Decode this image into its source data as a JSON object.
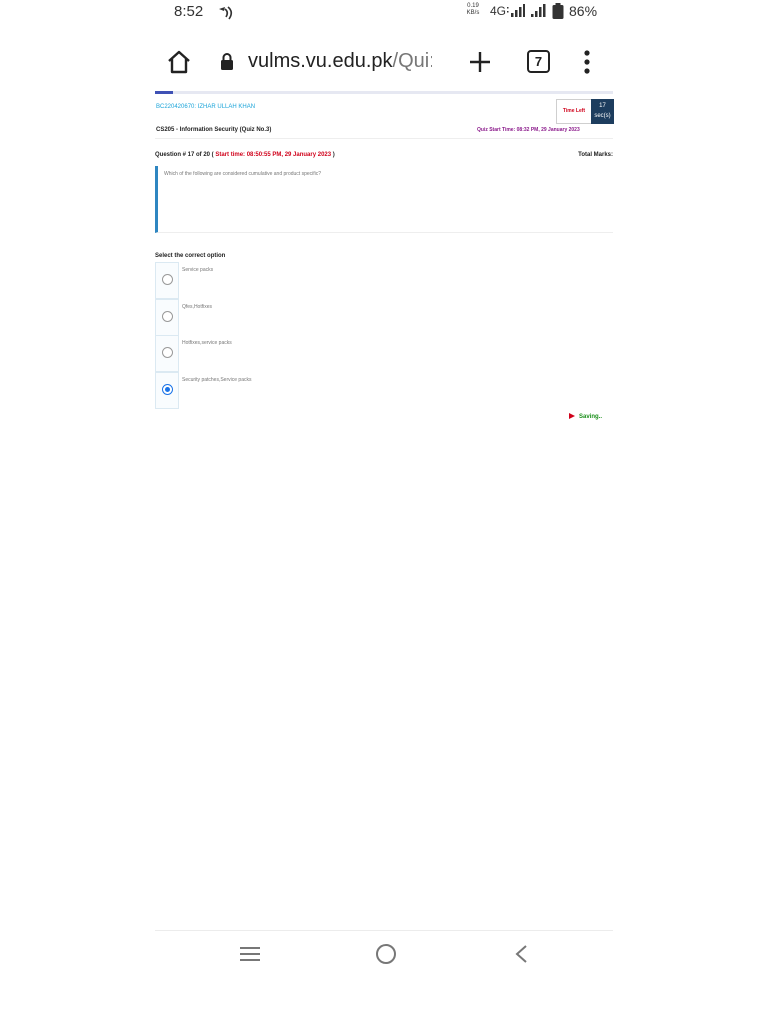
{
  "status_bar": {
    "time": "8:52",
    "net_speed": "0.19",
    "net_unit": "KB/s",
    "network": "4G",
    "battery": "86%"
  },
  "browser": {
    "url_host": "vulms.vu.edu.pk",
    "url_path": "/Qui:",
    "tab_count": "7",
    "page_progress_percent": 4
  },
  "quiz": {
    "student": "BC220420670: IZHAR ULLAH KHAN",
    "timer_label": "Time Left",
    "timer_value": "17",
    "timer_unit": "sec(s)",
    "course": "CS205 - Information Security (Quiz No.3)",
    "quiz_start": "Quiz Start Time: 08:32 PM, 29 January 2023",
    "question_number": "Question # 17 of 20 (",
    "question_start_time": "Start time: 08:50:55 PM, 29 January 2023",
    "question_close": ")",
    "total_marks": "Total Marks:",
    "question_text": "Which of the following are considered cumulative and product specific?",
    "select_label": "Select the correct option",
    "options": [
      {
        "label": "Service packs",
        "selected": false
      },
      {
        "label": "Qfes,Hotfixes",
        "selected": false
      },
      {
        "label": "Hotfixes,service packs",
        "selected": false
      },
      {
        "label": "Security patches,Service packs",
        "selected": true
      }
    ],
    "saving": "Saving.."
  },
  "colors": {
    "accent": "#1a73e8",
    "timer_bg": "#1d3d5e",
    "time_red": "#d0021b",
    "saving_green": "#1a8f1a",
    "student_blue": "#1ba4d9",
    "quiz_start_purple": "#8b1a8b"
  },
  "icons": {
    "home": "home-icon",
    "lock": "lock-icon",
    "new_tab": "plus-icon",
    "menu": "more-vert-icon",
    "nav_recents": "recents-icon",
    "nav_home": "circle-home-icon",
    "nav_back": "back-chevron-icon"
  }
}
